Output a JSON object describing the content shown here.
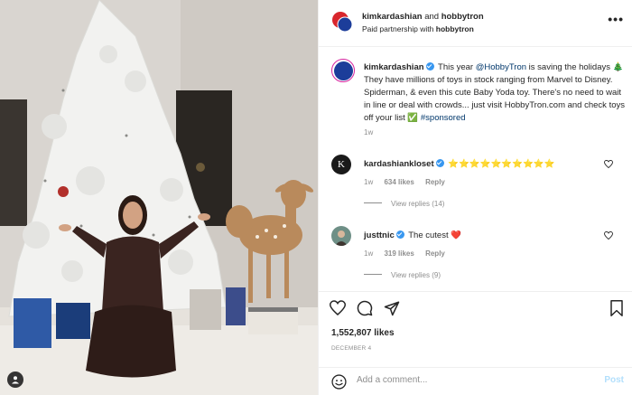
{
  "header": {
    "username": "kimkardashian",
    "and_text": "and",
    "partner": "hobbytron",
    "subtitle_prefix": "Paid partnership with",
    "subtitle_partner": "hobbytron",
    "more_label": "•••"
  },
  "caption": {
    "username": "kimkardashian",
    "text_1": "This year ",
    "mention": "@HobbyTron",
    "text_2": " is saving the holidays 🎄 They have millions of toys in stock ranging from Marvel to Disney. Spiderman, & even this cute Baby Yoda toy. There's no need to wait in line or deal with crowds... just visit HobbyTron.com and check toys off your list ✅ ",
    "hashtag": "#sponsored",
    "time": "1w"
  },
  "comments": [
    {
      "username": "kardashiankloset",
      "text": "⭐⭐⭐⭐⭐⭐⭐⭐⭐⭐",
      "avatar_letter": "K",
      "time": "1w",
      "likes": "634 likes",
      "reply": "Reply",
      "view_replies": "View replies (14)"
    },
    {
      "username": "justtnic",
      "text": "The cutest ❤️",
      "time": "1w",
      "likes": "319 likes",
      "reply": "Reply",
      "view_replies": "View replies (9)"
    }
  ],
  "actions": {
    "likes": "1,552,807 likes",
    "date": "DECEMBER 4"
  },
  "add_comment": {
    "placeholder": "Add a comment...",
    "post_label": "Post"
  },
  "icons": [
    "heart-icon",
    "comment-icon",
    "share-icon",
    "bookmark-icon",
    "emoji-icon",
    "tag-user-icon",
    "more-icon",
    "verified-icon"
  ],
  "colors": {
    "link": "#00376b",
    "verified": "#3897f0",
    "post_disabled": "#b2dffc",
    "muted": "#8e8e8e"
  }
}
